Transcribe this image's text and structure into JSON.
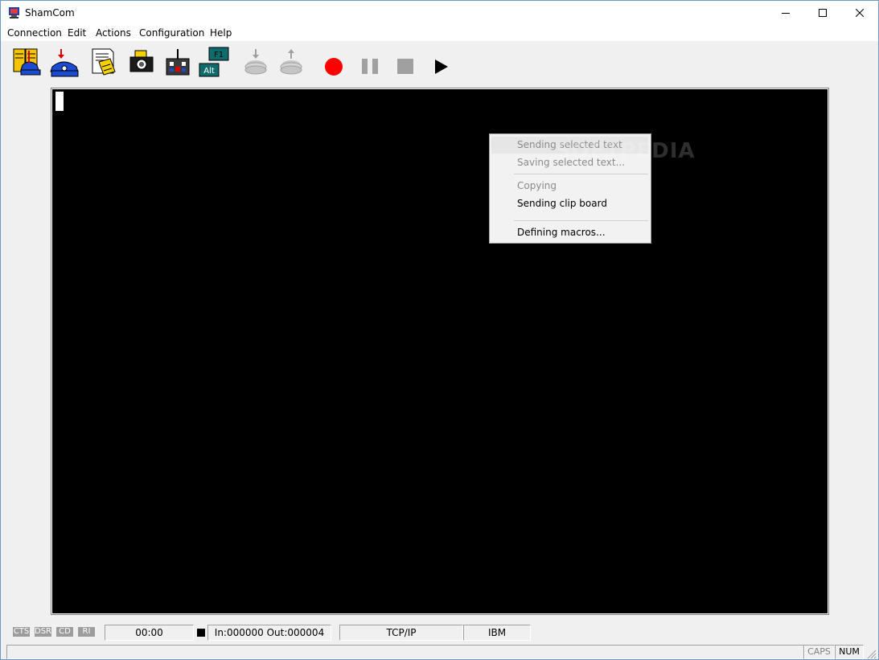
{
  "window": {
    "title": "ShamCom"
  },
  "menubar": {
    "items": [
      "Connection",
      "Edit",
      "Actions",
      "Configuration",
      "Help"
    ]
  },
  "toolbar": {
    "macro_f1_label": "F1",
    "macro_alt_label": "Alt",
    "record_color": "#ff0000",
    "disabled_color": "#a0a0a0"
  },
  "context_menu": {
    "items": [
      {
        "label": "Sending selected text",
        "enabled": false
      },
      {
        "label": "Saving selected text...",
        "enabled": false
      },
      {
        "label": "Copying",
        "enabled": false
      },
      {
        "label": "Sending clip board",
        "enabled": true
      },
      {
        "label": "Defining macros...",
        "enabled": true
      }
    ],
    "watermark": "SOFTPEDIA"
  },
  "status": {
    "leds": [
      "CTS",
      "DSR",
      "CD",
      "RI"
    ],
    "timer": "00:00",
    "io_counts": "In:000000 Out:000004",
    "protocol": "TCP/IP",
    "terminal_type": "IBM",
    "caps": "CAPS",
    "num": "NUM"
  }
}
